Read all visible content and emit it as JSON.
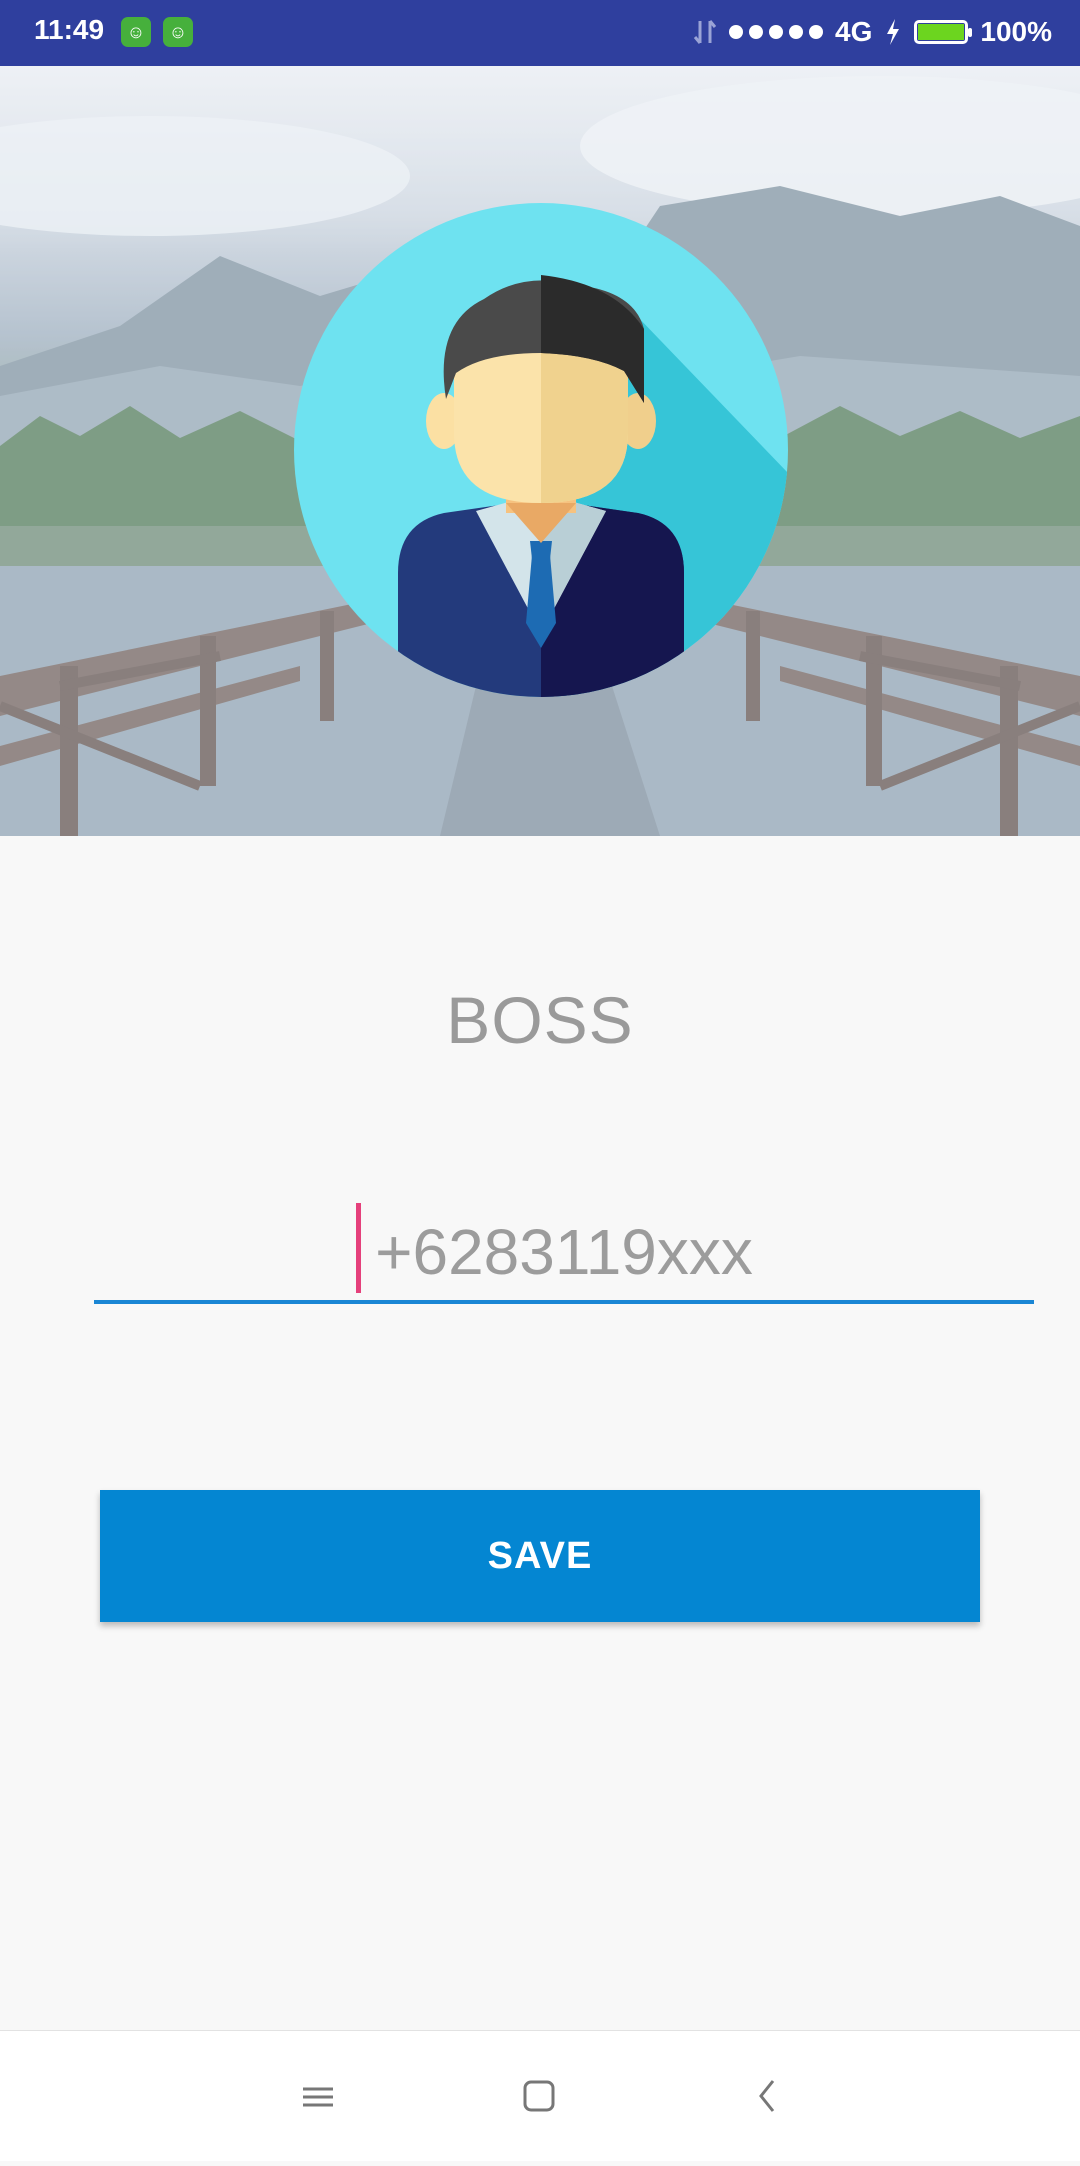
{
  "status_bar": {
    "time": "11:49",
    "network": "4G",
    "battery": "100%",
    "battery_level": 1.0,
    "notification_icons": [
      "android-app-icon",
      "android-app-icon"
    ]
  },
  "profile": {
    "name": "BOSS"
  },
  "phone": {
    "placeholder": "+6283119xxx",
    "value": ""
  },
  "actions": {
    "save_label": "SAVE"
  },
  "colors": {
    "status_bar": "#2f3f9e",
    "accent": "#0486d2",
    "cursor": "#e5407b",
    "avatar_bg": "#6ee2f0"
  },
  "nav": {
    "icons": [
      "menu-icon",
      "home-icon",
      "back-icon"
    ]
  }
}
